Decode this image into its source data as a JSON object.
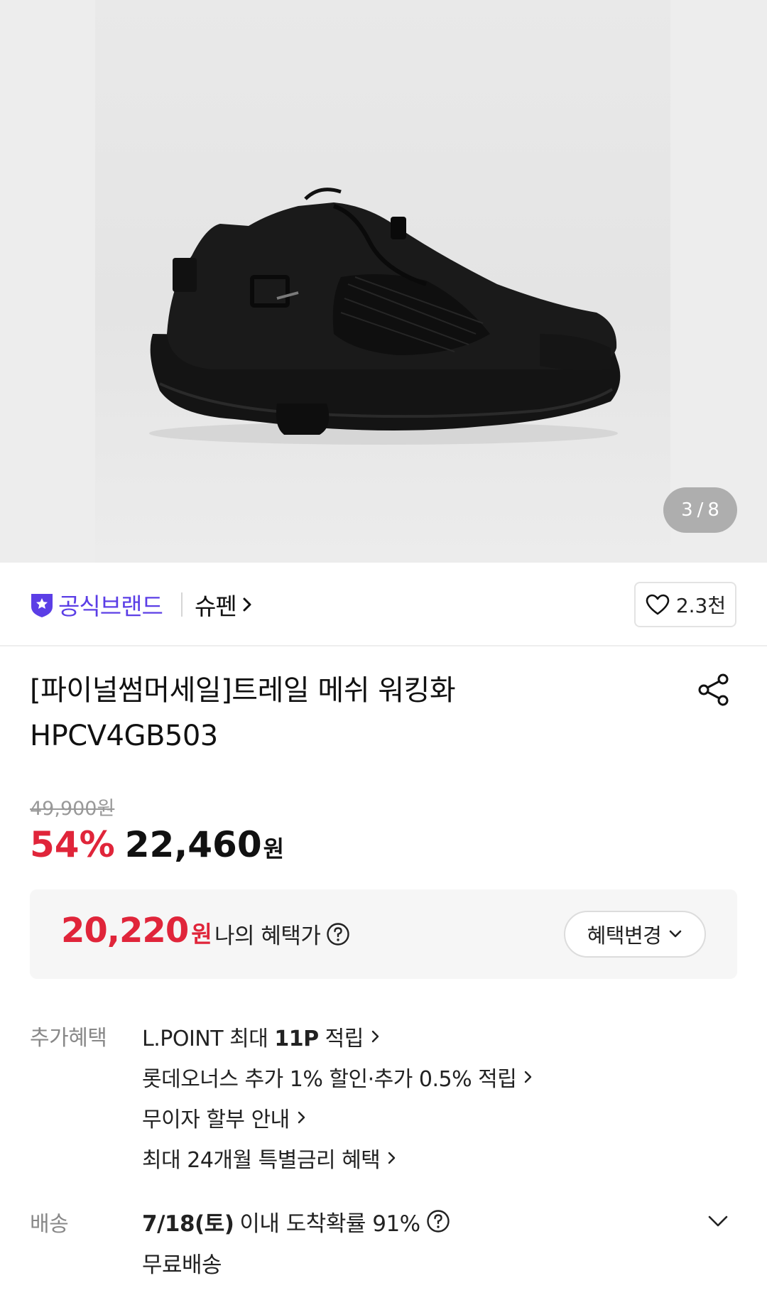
{
  "gallery": {
    "current": "3",
    "separator": "/",
    "total": "8"
  },
  "brand": {
    "official_label": "공식브랜드",
    "brand_name": "슈펜",
    "likes": "2.3천"
  },
  "product": {
    "title_line1": "[파이널썸머세일]트레일 메쉬 워킹화",
    "title_line2": "HPCV4GB503"
  },
  "price": {
    "original": "49,900원",
    "discount": "54%",
    "sale": "22,460",
    "currency": "원"
  },
  "my_benefit": {
    "price": "20,220",
    "currency": "원",
    "label": "나의 혜택가",
    "change_button": "혜택변경"
  },
  "extra_benefits": {
    "label": "추가혜택",
    "items": [
      {
        "prefix": "L.POINT 최대 ",
        "bold": "11P",
        "suffix": " 적립"
      },
      {
        "prefix": "롯데오너스 추가 1% 할인·추가 0.5% 적립",
        "bold": "",
        "suffix": ""
      },
      {
        "prefix": "무이자 할부 안내",
        "bold": "",
        "suffix": ""
      },
      {
        "prefix": "최대 24개월 특별금리 혜택",
        "bold": "",
        "suffix": ""
      }
    ]
  },
  "delivery": {
    "label": "배송",
    "date": "7/18(토)",
    "arrival_text": "이내 도착확률 91%",
    "shipping": "무료배송"
  },
  "colors": {
    "accent_red": "#e0253a",
    "brand_purple": "#5b3ee6"
  },
  "icons": {
    "official": "shield-star-icon",
    "like": "heart-icon",
    "share": "share-icon",
    "help": "question-circle-icon",
    "dropdown": "chevron-down-icon",
    "link": "chevron-right-icon"
  }
}
